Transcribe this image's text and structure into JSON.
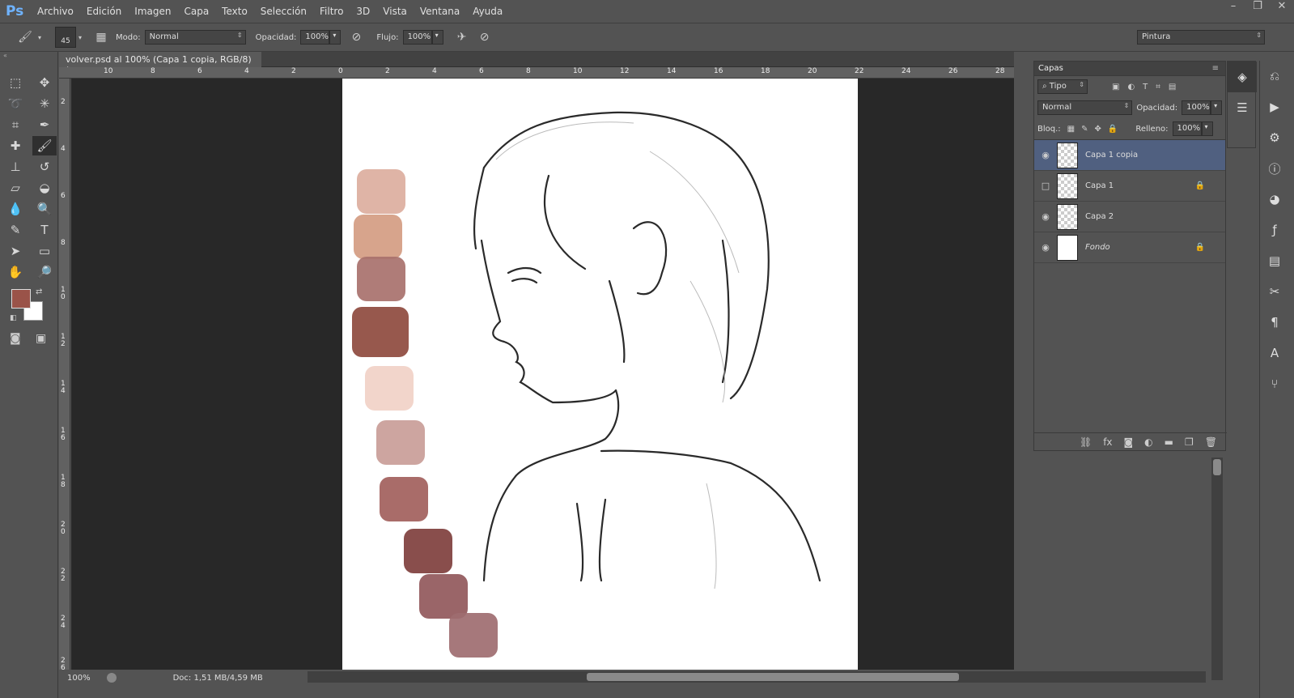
{
  "app": {
    "logo": "Ps"
  },
  "menu": [
    "Archivo",
    "Edición",
    "Imagen",
    "Capa",
    "Texto",
    "Selección",
    "Filtro",
    "3D",
    "Vista",
    "Ventana",
    "Ayuda"
  ],
  "window_controls": [
    "–",
    "❐",
    "✕"
  ],
  "options": {
    "brush_size": "45",
    "mode_label": "Modo:",
    "mode_value": "Normal",
    "opacity_label": "Opacidad:",
    "opacity_value": "100%",
    "flow_label": "Flujo:",
    "flow_value": "100%",
    "workspace": "Pintura"
  },
  "document_tab": {
    "title": "volver.psd al 100% (Capa 1 copia, RGB/8) *",
    "close": "×"
  },
  "ruler_h": [
    "10",
    "8",
    "6",
    "4",
    "2",
    "0",
    "2",
    "4",
    "6",
    "8",
    "10",
    "12",
    "14",
    "16",
    "18",
    "20",
    "22",
    "24",
    "26",
    "28"
  ],
  "ruler_v": [
    "2",
    "4",
    "6",
    "8",
    "10",
    "12",
    "14",
    "16",
    "18",
    "20",
    "22",
    "24",
    "26"
  ],
  "status": {
    "zoom": "100%",
    "doc": "Doc: 1,51 MB/4,59 MB"
  },
  "colors": {
    "foreground": "#9a5349",
    "background": "#ffffff"
  },
  "layers_panel": {
    "title": "Capas",
    "filter": "Tipo",
    "blend_mode": "Normal",
    "opacity_label": "Opacidad:",
    "opacity_value": "100%",
    "lock_label": "Bloq.:",
    "fill_label": "Relleno:",
    "fill_value": "100%",
    "layers": [
      {
        "name": "Capa 1 copia",
        "visible": true,
        "selected": true,
        "locked": false
      },
      {
        "name": "Capa 1",
        "visible": false,
        "selected": false,
        "locked": true
      },
      {
        "name": "Capa 2",
        "visible": true,
        "selected": false,
        "locked": false
      },
      {
        "name": "Fondo",
        "visible": true,
        "selected": false,
        "locked": true
      }
    ]
  },
  "palette_swatches": [
    "#dcae9e",
    "#d49c82",
    "#a8716c",
    "#8e4a3e",
    "#f1d1c7",
    "#c99d98",
    "#a2605c",
    "#7f3f3d",
    "#91585b",
    "#9e6c70"
  ],
  "toolbar_icons": [
    "marquee-icon",
    "move-icon",
    "lasso-icon",
    "magic-wand-icon",
    "crop-icon",
    "eyedropper-icon",
    "healing-icon",
    "brush-icon",
    "stamp-icon",
    "history-brush-icon",
    "eraser-icon",
    "bucket-icon",
    "blur-icon",
    "dodge-icon",
    "pen-icon",
    "type-icon",
    "path-select-icon",
    "shape-icon",
    "hand-icon",
    "zoom-icon"
  ]
}
